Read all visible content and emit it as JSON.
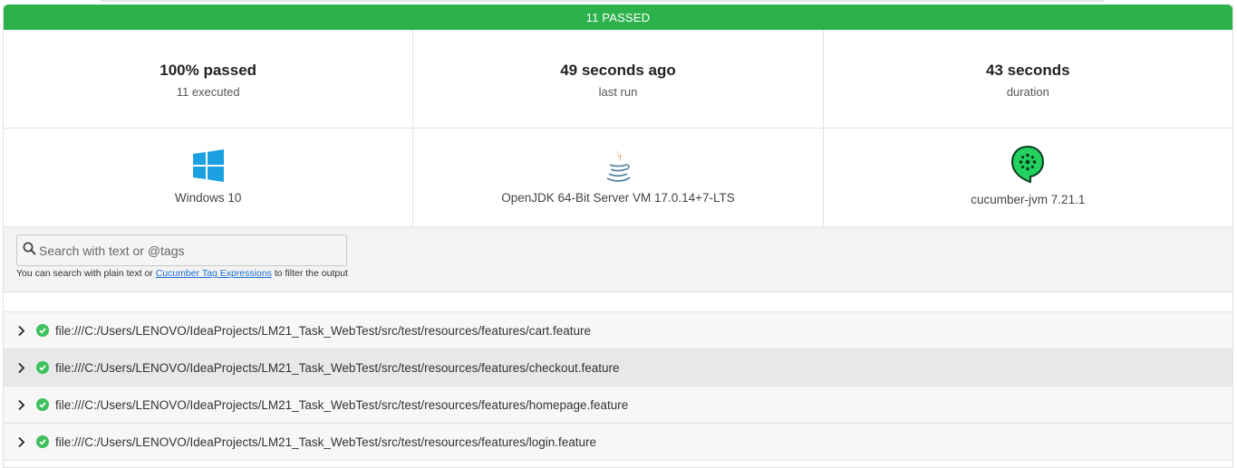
{
  "banner": {
    "status_text": "11 PASSED",
    "color": "#2db14b"
  },
  "stats": [
    {
      "main": "100% passed",
      "sub": "11 executed"
    },
    {
      "main": "49 seconds ago",
      "sub": "last run"
    },
    {
      "main": "43 seconds",
      "sub": "duration"
    }
  ],
  "environment": [
    {
      "icon": "windows-icon",
      "label": "Windows 10"
    },
    {
      "icon": "java-icon",
      "label": "OpenJDK 64-Bit Server VM 17.0.14+7-LTS"
    },
    {
      "icon": "cucumber-icon",
      "label": "cucumber-jvm 7.21.1"
    }
  ],
  "search": {
    "placeholder": "Search with text or @tags",
    "hint_prefix": "You can search with plain text or ",
    "hint_link": "Cucumber Tag Expressions",
    "hint_suffix": " to filter the output"
  },
  "features": [
    {
      "path": "file:///C:/Users/LENOVO/IdeaProjects/LM21_Task_WebTest/src/test/resources/features/cart.feature",
      "status": "passed"
    },
    {
      "path": "file:///C:/Users/LENOVO/IdeaProjects/LM21_Task_WebTest/src/test/resources/features/checkout.feature",
      "status": "passed"
    },
    {
      "path": "file:///C:/Users/LENOVO/IdeaProjects/LM21_Task_WebTest/src/test/resources/features/homepage.feature",
      "status": "passed"
    },
    {
      "path": "file:///C:/Users/LENOVO/IdeaProjects/LM21_Task_WebTest/src/test/resources/features/login.feature",
      "status": "passed"
    }
  ],
  "colors": {
    "passed": "#3ec05e",
    "windows": "#1ba1e2",
    "cucumber": "#23d160",
    "link": "#1a6fd1"
  }
}
